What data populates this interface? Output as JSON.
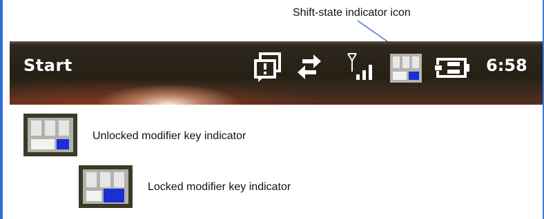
{
  "callout": {
    "text": "Shift-state indicator icon"
  },
  "taskbar": {
    "start_label": "Start",
    "clock": "6:58",
    "icons": [
      "notification-icon",
      "sync-arrows-icon",
      "signal-strength-icon",
      "shift-state-icon",
      "battery-plug-icon"
    ]
  },
  "legend": {
    "unlocked_label": "Unlocked modifier key indicator",
    "locked_label": "Locked modifier key indicator"
  },
  "colors": {
    "frame": "#2f6fd6",
    "indicator_blue": "#1a2fd6",
    "taskbar_bg": "#2a2418"
  }
}
